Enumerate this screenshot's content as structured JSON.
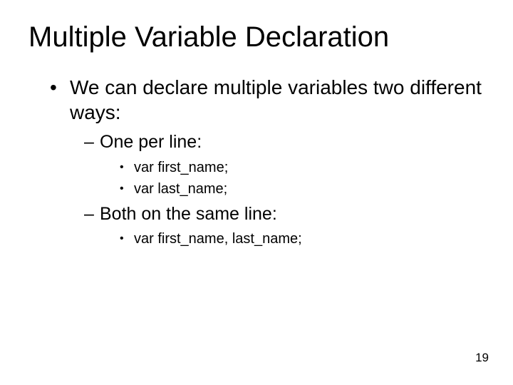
{
  "title": "Multiple Variable Declaration",
  "bullet1": "We can declare multiple variables two different ways:",
  "sub1": "One per line:",
  "code1a": "var first_name;",
  "code1b": "var last_name;",
  "sub2": "Both on the same line:",
  "code2a": "var first_name, last_name;",
  "page_number": "19"
}
